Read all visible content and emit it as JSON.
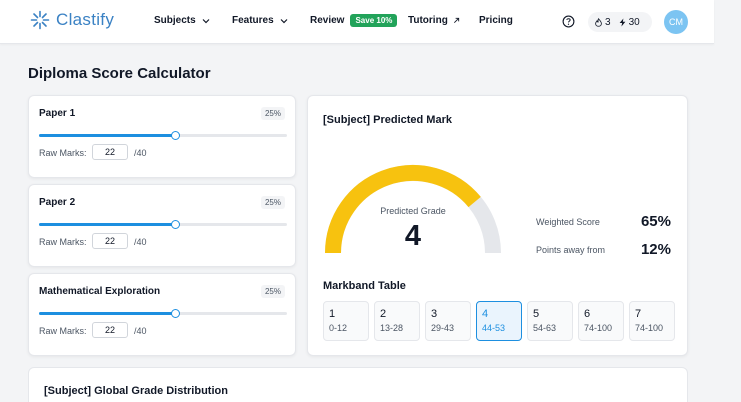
{
  "brand": {
    "name": "Clastify",
    "color": "#3b82c4"
  },
  "nav": {
    "subjects": "Subjects",
    "features": "Features",
    "review": "Review",
    "review_badge": "Save 10%",
    "tutoring": "Tutoring",
    "pricing": "Pricing"
  },
  "header": {
    "help_icon": "question-circle-icon",
    "flame_icon": "flame-icon",
    "flame_count": "3",
    "bolt_icon": "bolt-icon",
    "bolt_count": "30",
    "avatar_initials": "CM"
  },
  "page": {
    "title": "Diploma Score Calculator"
  },
  "papers": [
    {
      "name": "Paper 1",
      "weight": "25%",
      "raw_label": "Raw Marks:",
      "value": "22",
      "max": "/40",
      "fill_fraction": 0.55
    },
    {
      "name": "Paper 2",
      "weight": "25%",
      "raw_label": "Raw Marks:",
      "value": "22",
      "max": "/40",
      "fill_fraction": 0.55
    },
    {
      "name": "Mathematical Exploration",
      "weight": "25%",
      "raw_label": "Raw Marks:",
      "value": "22",
      "max": "/40",
      "fill_fraction": 0.55
    }
  ],
  "prediction": {
    "title": "[Subject] Predicted Mark",
    "grade_label": "Predicted Grade",
    "grade": "4",
    "gauge_fraction": 0.78,
    "weighted_label": "Weighted Score",
    "weighted_value": "65%",
    "away_label": "Points away from",
    "away_value": "12%"
  },
  "markband": {
    "title": "Markband Table",
    "active_index": 3,
    "bands": [
      {
        "grade": "1",
        "range": "0-12"
      },
      {
        "grade": "2",
        "range": "13-28"
      },
      {
        "grade": "3",
        "range": "29-43"
      },
      {
        "grade": "4",
        "range": "44-53"
      },
      {
        "grade": "5",
        "range": "54-63"
      },
      {
        "grade": "6",
        "range": "74-100"
      },
      {
        "grade": "7",
        "range": "74-100"
      }
    ]
  },
  "distribution": {
    "title": "[Subject] Global Grade Distribution"
  },
  "colors": {
    "accent": "#1d8fe0",
    "gauge": "#f7c20f",
    "gauge_track": "#e5e7eb",
    "save_badge": "#22a35a"
  }
}
